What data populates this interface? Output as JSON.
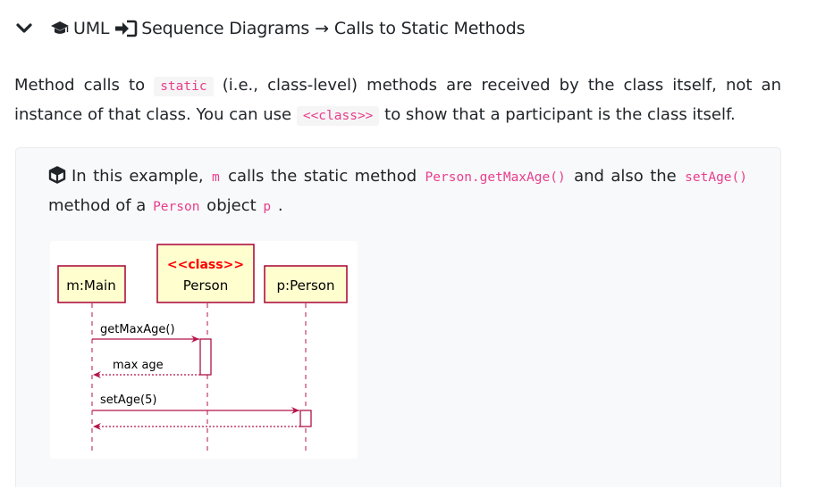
{
  "heading": {
    "part1": "UML",
    "part2": "Sequence Diagrams",
    "arrow": "→",
    "part3": "Calls to Static Methods"
  },
  "intro": {
    "t1": "Method calls to ",
    "code_static": "static",
    "t2": " (i.e., class-level) methods are received by the class itself, not an instance of that class. You can use ",
    "code_class": "<<class>>",
    "t3": " to show that a participant is the class itself."
  },
  "example": {
    "t1": "In this example, ",
    "code_m": "m",
    "t2": " calls the static method ",
    "code_getmax": "Person.getMaxAge()",
    "t3": " and also the ",
    "code_setage": "setAge()",
    "t4": " method of a ",
    "code_person": "Person",
    "t5": " object ",
    "code_p": "p",
    "t6": " ."
  },
  "diagram": {
    "participants": {
      "main": "m:Main",
      "class_stereotype": "<<class>>",
      "person_class": "Person",
      "person_obj": "p:Person"
    },
    "messages": {
      "getmaxage": "getMaxAge()",
      "max_age": "max age",
      "setage": "setAge(5)"
    }
  },
  "colors": {
    "message": "#b5134b",
    "participant_fill": "#fefece",
    "participant_border": "#a80036",
    "stereotype": "#ff0000",
    "code": "#e83e8c"
  },
  "icons": [
    "chevron-down-icon",
    "graduation-cap-icon",
    "sign-in-icon",
    "cube-icon"
  ]
}
